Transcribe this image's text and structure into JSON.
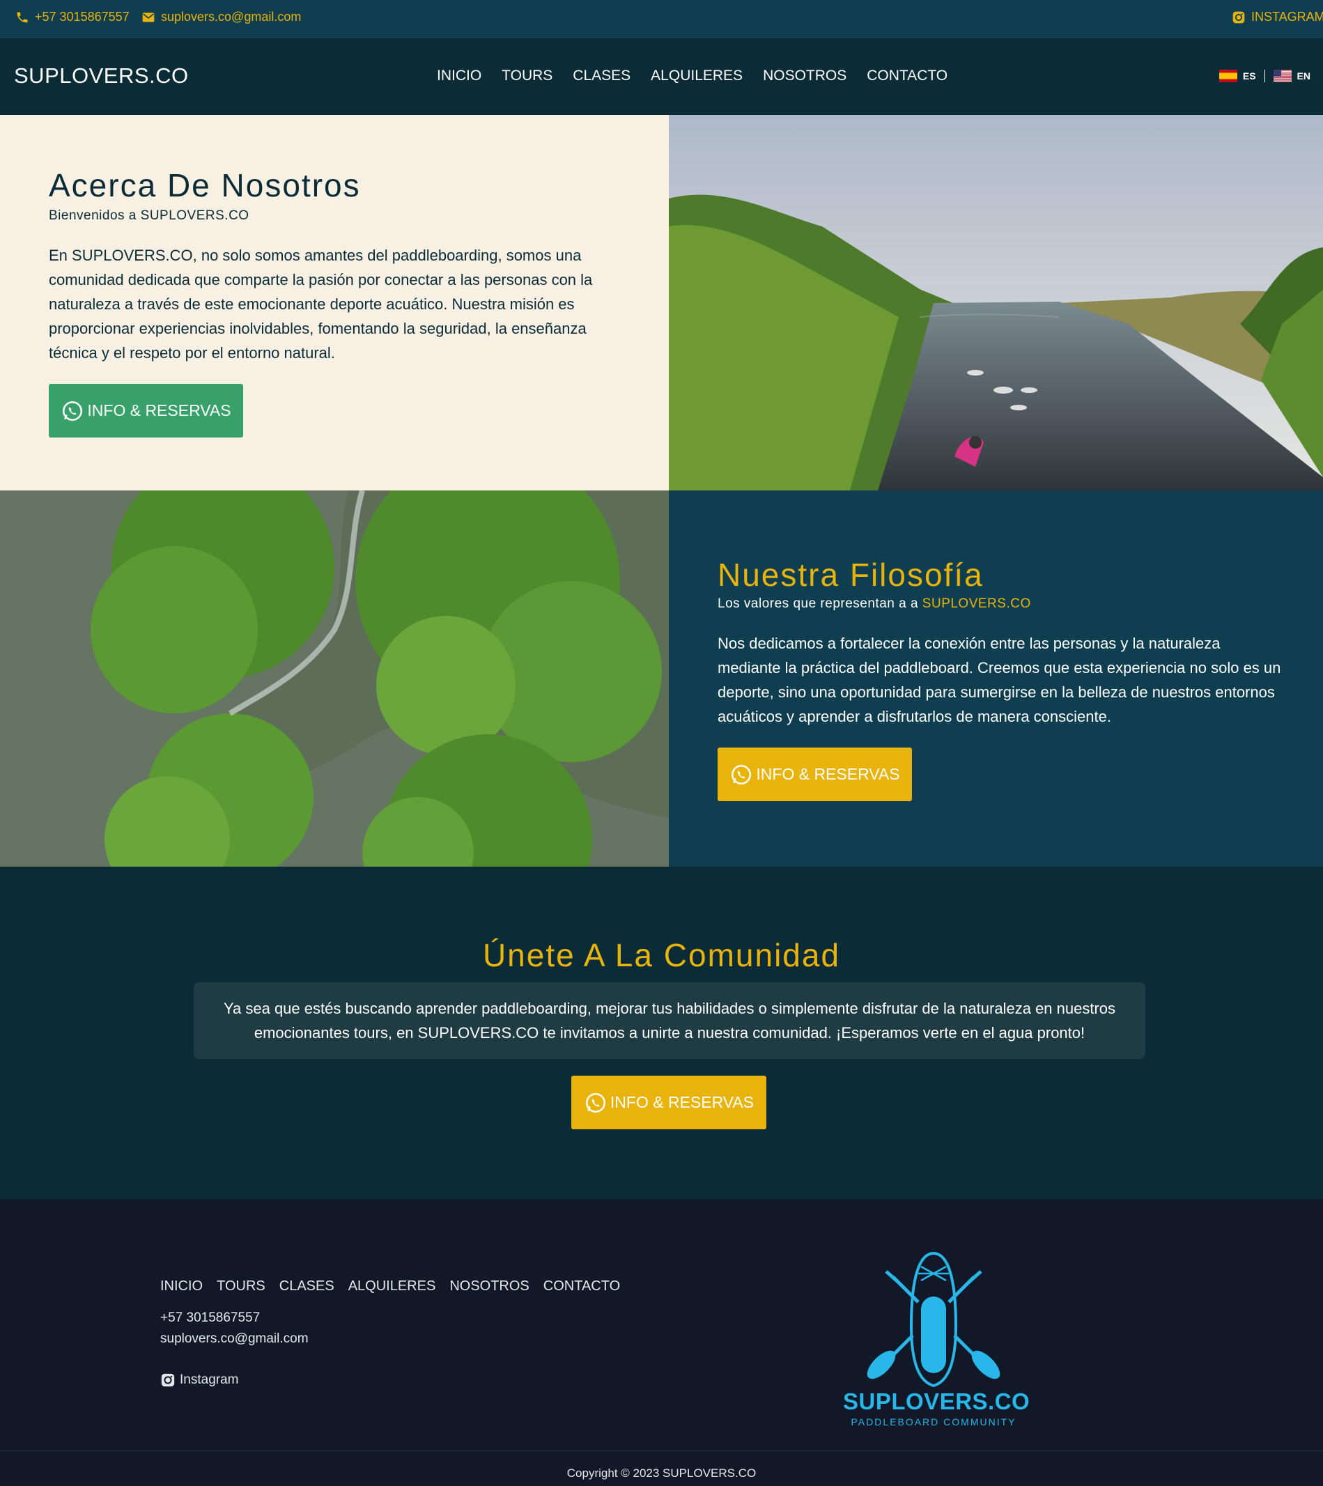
{
  "topbar": {
    "phone": "+57 3015867557",
    "email": "suplovers.co@gmail.com",
    "instagram": "INSTAGRAM"
  },
  "header": {
    "brand": "SUPLOVERS.CO",
    "nav": [
      "INICIO",
      "TOURS",
      "CLASES",
      "ALQUILERES",
      "NOSOTROS",
      "CONTACTO"
    ],
    "lang_es": "ES",
    "lang_en": "EN"
  },
  "about": {
    "title": "Acerca De Nosotros",
    "subtitle": "Bienvenidos a SUPLOVERS.CO",
    "body": "En SUPLOVERS.CO, no solo somos amantes del paddleboarding, somos una comunidad dedicada que comparte la pasión por conectar a las personas con la naturaleza a través de este emocionante deporte acuático. Nuestra misión es proporcionar experiencias inolvidables, fomentando la seguridad, la enseñanza técnica y el respeto por el entorno natural.",
    "button": "INFO & RESERVAS"
  },
  "philosophy": {
    "title": "Nuestra Filosofía",
    "subtitle_prefix": "Los valores que representan a a ",
    "subtitle_brand": "SUPLOVERS.CO",
    "body": "Nos dedicamos a fortalecer la conexión entre las personas y la naturaleza mediante la práctica del paddleboard. Creemos que esta experiencia no solo es un deporte, sino una oportunidad para sumergirse en la belleza de nuestros entornos acuáticos y aprender a disfrutarlos de manera consciente.",
    "button": "INFO & RESERVAS"
  },
  "community": {
    "title": "Únete A La Comunidad",
    "body": "Ya sea que estés buscando aprender paddleboarding, mejorar tus habilidades o simplemente disfrutar de la naturaleza en nuestros emocionantes tours, en SUPLOVERS.CO te invitamos a unirte a nuestra comunidad. ¡Esperamos verte en el agua pronto!",
    "button": "INFO & RESERVAS"
  },
  "footer": {
    "nav": [
      "INICIO",
      "TOURS",
      "CLASES",
      "ALQUILERES",
      "NOSOTROS",
      "CONTACTO"
    ],
    "phone": "+57 3015867557",
    "email": "suplovers.co@gmail.com",
    "instagram": "Instagram",
    "logo_name": "SUPLOVERS.CO",
    "logo_tagline": "PADDLEBOARD COMMUNITY",
    "copyright": "Copyright © 2023 SUPLOVERS.CO"
  },
  "colors": {
    "accent": "#e8b40c",
    "topbar": "#0e3e4f",
    "header": "#0b2c37",
    "cream": "#f7f0e3",
    "whatsapp_green": "#38a169",
    "footer": "#111827",
    "logo_blue": "#29b6e8"
  }
}
